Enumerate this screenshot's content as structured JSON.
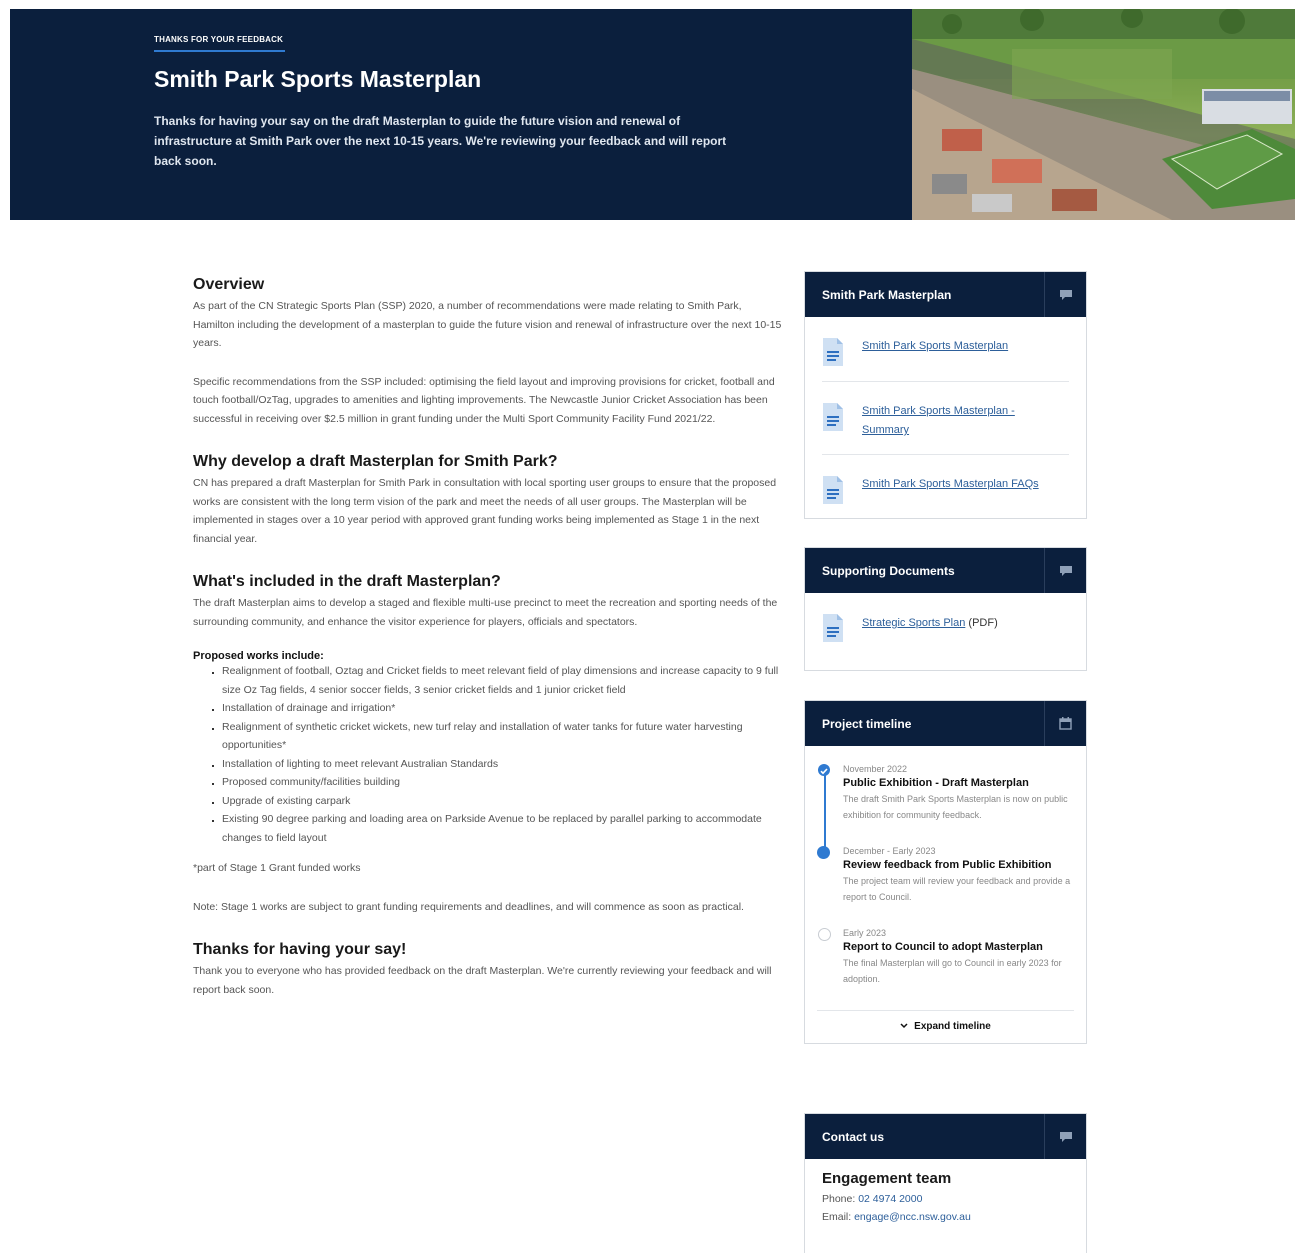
{
  "hero": {
    "eyebrow": "THANKS FOR YOUR FEEDBACK",
    "title": "Smith Park Sports Masterplan",
    "description": "Thanks for having your say on the draft Masterplan to guide the future vision and renewal of infrastructure at Smith Park over the next 10-15 years. We're reviewing your feedback and will report back soon."
  },
  "main": {
    "overview_title": "Overview",
    "overview_p1": "As part of the CN Strategic Sports Plan (SSP) 2020, a number of recommendations were made relating to Smith Park, Hamilton including the development of a masterplan to guide the future vision and renewal of infrastructure over the next 10-15 years.",
    "overview_p2": "Specific recommendations from the SSP included: optimising the field layout and improving provisions for cricket, football and touch football/OzTag, upgrades to amenities and lighting improvements. The Newcastle Junior Cricket Association has been successful in receiving over $2.5 million in grant funding under the Multi Sport Community Facility Fund 2021/22.",
    "why_title": "Why develop a draft Masterplan for Smith Park?",
    "why_p": "CN has prepared a draft Masterplan for Smith Park in consultation with local sporting user groups to ensure that the proposed works are consistent with the long term vision of the park and meet the needs of all user groups. The Masterplan will be implemented in stages over a 10 year period with approved grant funding works being implemented as Stage 1 in the next financial year.",
    "included_title": "What's included in the draft Masterplan?",
    "included_p": "The draft Masterplan aims to develop a staged and flexible multi-use precinct to meet the recreation and sporting needs of the surrounding community, and enhance the visitor experience for players, officials and spectators.",
    "works_label": "Proposed works include:",
    "works": [
      "Realignment of football, Oztag and Cricket fields to meet relevant field of play dimensions and increase capacity to 9 full size Oz Tag fields, 4 senior soccer fields, 3 senior cricket fields and 1 junior cricket field",
      "Installation of drainage and irrigation*",
      "Realignment of synthetic cricket wickets, new turf relay and installation of water tanks for future water harvesting opportunities*",
      "Installation of lighting to meet relevant Australian Standards",
      "Proposed community/facilities building",
      "Upgrade of existing carpark",
      "Existing 90 degree parking and loading area on Parkside Avenue to be replaced by parallel parking to accommodate changes to field layout"
    ],
    "footnote": "*part of Stage 1 Grant funded works",
    "note": "Note: Stage 1 works are subject to grant funding requirements and deadlines, and will commence as soon as practical.",
    "thanks_title": "Thanks for having your say!",
    "thanks_p": "Thank you to everyone who has provided feedback on the draft Masterplan. We're currently reviewing your feedback and will report back soon."
  },
  "masterplan_card": {
    "title": "Smith Park Masterplan",
    "docs": [
      "Smith Park Sports Masterplan",
      "Smith Park Sports Masterplan - Summary",
      "Smith Park Sports Masterplan FAQs"
    ]
  },
  "supporting_card": {
    "title": "Supporting Documents",
    "doc_link": "Strategic Sports Plan",
    "doc_suffix": " (PDF)"
  },
  "timeline_card": {
    "title": "Project timeline",
    "items": [
      {
        "date": "November 2022",
        "heading": "Public Exhibition - Draft Masterplan",
        "desc": "The draft Smith Park Sports Masterplan is now on public exhibition for community feedback."
      },
      {
        "date": "December - Early 2023",
        "heading": "Review feedback from Public Exhibition",
        "desc": "The project team will review your feedback and provide a report to Council."
      },
      {
        "date": "Early 2023",
        "heading": "Report to Council to adopt Masterplan",
        "desc": "The final Masterplan will go to Council in early 2023 for adoption."
      }
    ],
    "expand_label": "Expand timeline"
  },
  "contact_card": {
    "title": "Contact us",
    "name": "Engagement team",
    "phone_label": "Phone: ",
    "phone": "02 4974 2000",
    "email_label": "Email: ",
    "email": "engage@ncc.nsw.gov.au"
  },
  "colors": {
    "navy": "#0b1f3d",
    "accent": "#2f7ad1",
    "link": "#2d5f9a"
  },
  "icons": [
    "chat-icon",
    "document-icon",
    "calendar-icon",
    "check-icon",
    "chevron-down-icon"
  ]
}
